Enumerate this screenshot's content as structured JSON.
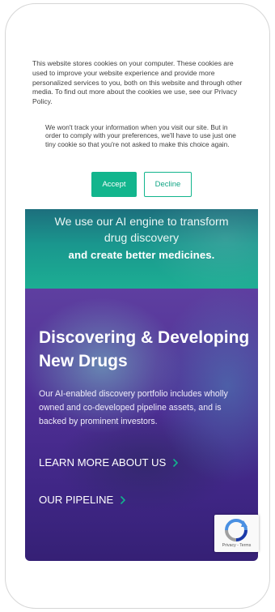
{
  "cookie_banner": {
    "message_primary": "This website stores cookies on your computer. These cookies are used to improve your website experience and provide more personalized services to you, both on this website and through other media. To find out more about the cookies we use, see our Privacy Policy.",
    "message_secondary": "We won't track your information when you visit our site. But in order to comply with your preferences, we'll have to use just one tiny cookie so that you're not asked to make this choice again.",
    "accept_label": "Accept",
    "decline_label": "Decline"
  },
  "intro": {
    "line1": "We use our AI engine to transform",
    "line2": "drug discovery",
    "line3": "and create better medicines."
  },
  "hero": {
    "title": "Discovering & Developing New Drugs",
    "description": "Our AI-enabled discovery portfolio includes wholly owned and co-developed pipeline assets, and is backed by prominent investors.",
    "cta_learn_more": "LEARN MORE ABOUT US",
    "cta_pipeline": "OUR PIPELINE"
  },
  "recaptcha": {
    "terms": "Privacy - Terms"
  },
  "colors": {
    "accent": "#12b58d",
    "hero_purple": "#4f2f95",
    "band_teal": "#1a978e"
  },
  "icons": [
    "chevron-right-icon",
    "recaptcha-logo-icon"
  ]
}
